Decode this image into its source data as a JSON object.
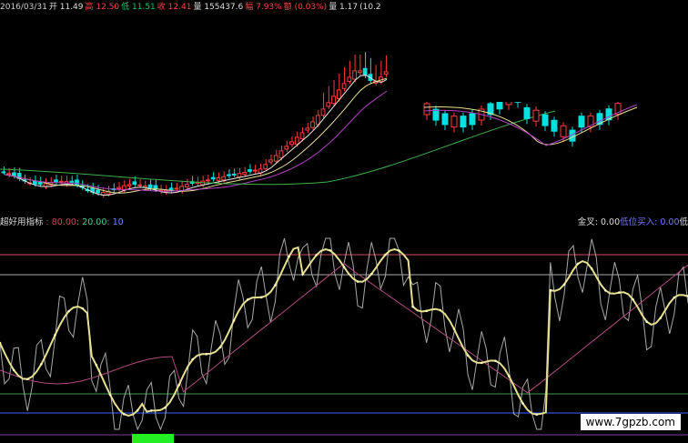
{
  "price_panel": {
    "legend_items": [
      {
        "text": "2016/03/31",
        "color": "#cccccc"
      },
      {
        "text": "开 11.49",
        "color": "#dddddd"
      },
      {
        "text": "高 12.50",
        "color": "#ff4040"
      },
      {
        "text": "低 11.51",
        "color": "#00cc66"
      },
      {
        "text": "收 12.41",
        "color": "#ff4040"
      },
      {
        "text": "量 155437.6",
        "color": "#dddddd"
      },
      {
        "text": "幅 7.93%",
        "color": "#ff4040"
      },
      {
        "text": "额 (0.03%)",
        "color": "#ff4040"
      },
      {
        "text": "量 1.17",
        "color": "#dddddd"
      },
      {
        "text": "(10.2",
        "color": "#dddddd"
      }
    ]
  },
  "indicator_panel": {
    "name": "超好用指标",
    "values": [
      {
        "text": ": 80.00",
        "color": "#cc4455"
      },
      {
        "text": ": 20.00",
        "color": "#44cc88"
      },
      {
        "text": ": 10",
        "color": "#6688ff"
      }
    ],
    "right_values": [
      {
        "text": "金叉: 0.00",
        "color": "#dddddd"
      },
      {
        "text": "低位买入: 0.00",
        "color": "#7777ff"
      },
      {
        "text": "低",
        "color": "#dddddd"
      }
    ]
  },
  "watermark": "www.7gpzb.com",
  "colors": {
    "up": "#ff3b3b",
    "down": "#00e0e0",
    "ma_white": "#e8e8e8",
    "ma_yellow": "#e8e090",
    "ma_purple": "#b040c0",
    "ma_green": "#3cb04a",
    "ref_red": "#d05060",
    "ref_green": "#3ca050",
    "ref_blue": "#4060ff",
    "ref_gray": "#aaaaaa",
    "signal_green": "#22ee22"
  }
}
